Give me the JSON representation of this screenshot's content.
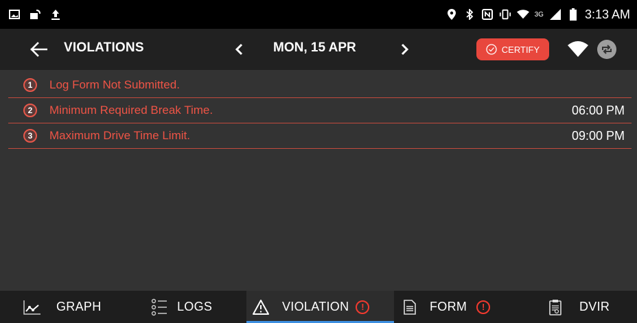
{
  "status_bar": {
    "time": "3:13 AM",
    "network": "3G",
    "icons": [
      "gallery-icon",
      "cast-icon",
      "upload-icon",
      "location-icon",
      "bluetooth-icon",
      "nfc-icon",
      "vibrate-icon",
      "wifi-icon",
      "signal-icon",
      "battery-icon"
    ]
  },
  "app_bar": {
    "title": "VIOLATIONS",
    "date": "MON, 15 APR",
    "certify_label": "CERTIFY",
    "accent": "#e8473d"
  },
  "violations": [
    {
      "number": "1",
      "text": "Log Form Not Submitted.",
      "time": ""
    },
    {
      "number": "2",
      "text": "Minimum Required Break Time.",
      "time": "06:00 PM"
    },
    {
      "number": "3",
      "text": "Maximum Drive Time Limit.",
      "time": "09:00 PM"
    }
  ],
  "bottom_nav": {
    "graph": "GRAPH",
    "logs": "LOGS",
    "violation": "VIOLATION",
    "form": "FORM",
    "dvir": "DVIR",
    "alert_symbol": "!",
    "active_tab": "VIOLATION",
    "active_color": "#3d8fe0"
  }
}
